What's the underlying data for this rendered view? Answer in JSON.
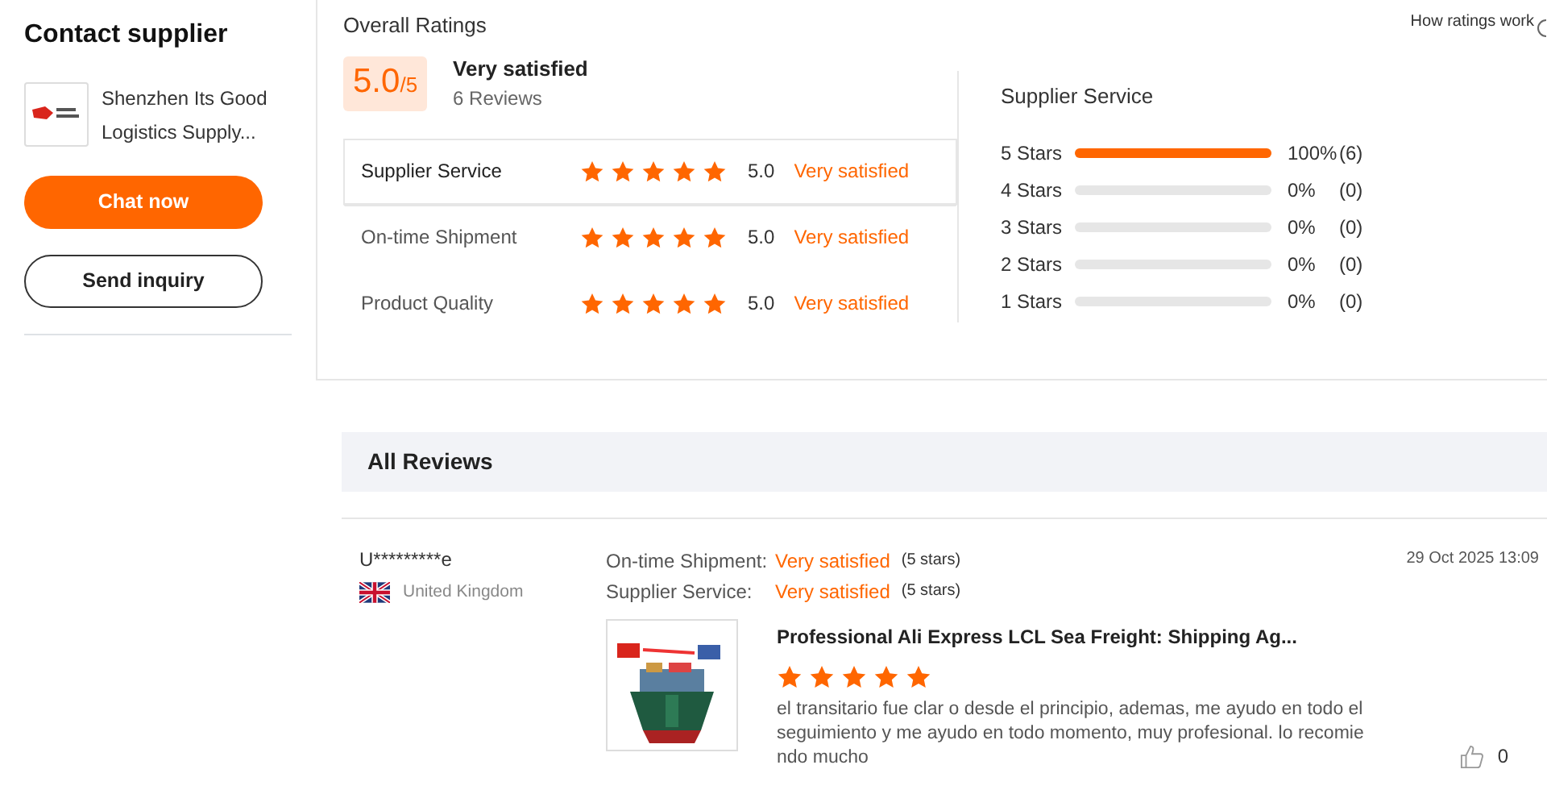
{
  "contact": {
    "title": "Contact supplier",
    "company": "Shenzhen Its Good Logistics Supply...",
    "buttons": [
      {
        "label": "Chat now",
        "kind": "primary"
      },
      {
        "label": "Send inquiry",
        "kind": "outline"
      }
    ]
  },
  "overall": {
    "title": "Overall Ratings",
    "help": "How ratings work",
    "score": "5.0",
    "out_of": "/5",
    "verdict": "Very satisfied",
    "reviews": "6 Reviews",
    "categories": [
      {
        "label": "Supplier Service",
        "stars": 5,
        "score": "5.0",
        "verdict": "Very satisfied",
        "selected": true
      },
      {
        "label": "On-time Shipment",
        "stars": 5,
        "score": "5.0",
        "verdict": "Very satisfied",
        "selected": false
      },
      {
        "label": "Product Quality",
        "stars": 5,
        "score": "5.0",
        "verdict": "Very satisfied",
        "selected": false
      }
    ],
    "distribution": {
      "title": "Supplier Service",
      "rows": [
        {
          "label": "5 Stars",
          "level": 1,
          "percent": "100%",
          "count": "(6)"
        },
        {
          "label": "4 Stars",
          "level": 0,
          "percent": "0%",
          "count": "(0)"
        },
        {
          "label": "3 Stars",
          "level": 0,
          "percent": "0%",
          "count": "(0)"
        },
        {
          "label": "2 Stars",
          "level": 0,
          "percent": "0%",
          "count": "(0)"
        },
        {
          "label": "1 Stars",
          "level": 0,
          "percent": "0%",
          "count": "(0)"
        }
      ]
    }
  },
  "reviews": {
    "title": "All Reviews",
    "items": [
      {
        "user": "U*********e",
        "country": "United Kingdom",
        "date": "29 Oct 2025 13:09",
        "ratings": [
          {
            "label": "On-time Shipment:",
            "verdict": "Very satisfied",
            "stars_text": "(5 stars)"
          },
          {
            "label": "Supplier Service:",
            "verdict": "Very satisfied",
            "stars_text": "(5 stars)"
          }
        ],
        "product": "Professional Ali Express LCL Sea Freight: Shipping Ag...",
        "stars": 5,
        "comment": "el transitario fue clar o desde el principio, ademas, me ayudo en todo el seguimiento y me ayudo en todo momento, muy profesional. lo recomiendo mucho",
        "likes": "0"
      }
    ]
  }
}
